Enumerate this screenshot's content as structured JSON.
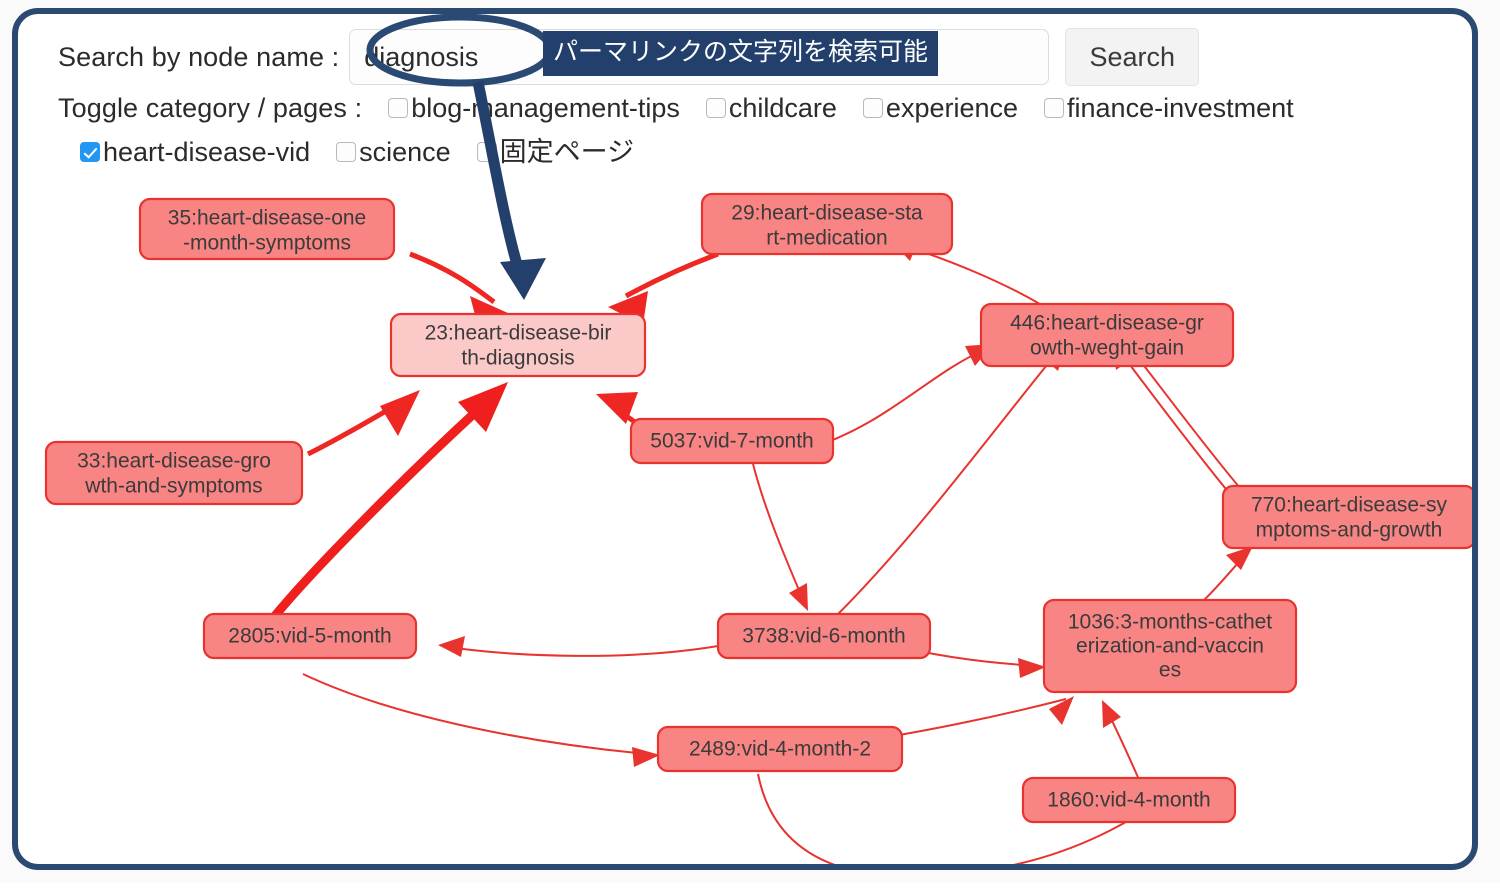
{
  "search": {
    "label": "Search by node name :",
    "value": "diagnosis",
    "placeholder": "",
    "button_label": "Search"
  },
  "annotation": {
    "text": "パーマリンクの文字列を検索可能",
    "bg_color": "#22406b",
    "text_color": "#ffffff",
    "target": "23:heart-disease-birth-diagnosis"
  },
  "toggles": {
    "label": "Toggle category / pages :",
    "items": [
      {
        "label": "blog-management-tips",
        "checked": false
      },
      {
        "label": "childcare",
        "checked": false
      },
      {
        "label": "experience",
        "checked": false
      },
      {
        "label": "finance-investment",
        "checked": false
      },
      {
        "label": "heart-disease-vid",
        "checked": true
      },
      {
        "label": "science",
        "checked": false
      },
      {
        "label": "固定ページ",
        "checked": false
      }
    ]
  },
  "colors": {
    "frame": "#2b4a73",
    "node_fill": "#f98484",
    "node_highlight_fill": "#fcc9c9",
    "node_stroke": "#e8332f",
    "edge": "#e8332f",
    "checkbox_checked": "#2196f3"
  },
  "graph": {
    "highlighted_node_id": "23",
    "nodes": [
      {
        "id": "35",
        "label": "35:heart-disease-one-month-symptoms",
        "lines": [
          "35:heart-disease-one",
          "-month-symptoms"
        ]
      },
      {
        "id": "29",
        "label": "29:heart-disease-start-medication",
        "lines": [
          "29:heart-disease-sta",
          "rt-medication"
        ]
      },
      {
        "id": "23",
        "label": "23:heart-disease-birth-diagnosis",
        "lines": [
          "23:heart-disease-bir",
          "th-diagnosis"
        ]
      },
      {
        "id": "446",
        "label": "446:heart-disease-growth-weght-gain",
        "lines": [
          "446:heart-disease-gr",
          "owth-weght-gain"
        ]
      },
      {
        "id": "33",
        "label": "33:heart-disease-growth-and-symptoms",
        "lines": [
          "33:heart-disease-gro",
          "wth-and-symptoms"
        ]
      },
      {
        "id": "5037",
        "label": "5037:vid-7-month",
        "lines": [
          "5037:vid-7-month"
        ]
      },
      {
        "id": "770",
        "label": "770:heart-disease-symptoms-and-growth",
        "lines": [
          "770:heart-disease-sy",
          "mptoms-and-growth"
        ]
      },
      {
        "id": "2805",
        "label": "2805:vid-5-month",
        "lines": [
          "2805:vid-5-month"
        ]
      },
      {
        "id": "3738",
        "label": "3738:vid-6-month",
        "lines": [
          "3738:vid-6-month"
        ]
      },
      {
        "id": "1036",
        "label": "1036:3-months-catheterization-and-vaccines",
        "lines": [
          "1036:3-months-cathet",
          "erization-and-vaccin",
          "es"
        ]
      },
      {
        "id": "2489",
        "label": "2489:vid-4-month-2",
        "lines": [
          "2489:vid-4-month-2"
        ]
      },
      {
        "id": "1860",
        "label": "1860:vid-4-month",
        "lines": [
          "1860:vid-4-month"
        ]
      }
    ],
    "edges": [
      {
        "from": "35",
        "to": "23",
        "weight": "mid"
      },
      {
        "from": "29",
        "to": "23",
        "weight": "mid"
      },
      {
        "from": "33",
        "to": "23",
        "weight": "mid"
      },
      {
        "from": "5037",
        "to": "23",
        "weight": "mid"
      },
      {
        "from": "2805",
        "to": "23",
        "weight": "thick"
      },
      {
        "from": "446",
        "to": "29",
        "weight": "thin"
      },
      {
        "from": "5037",
        "to": "446",
        "weight": "thin"
      },
      {
        "from": "3738",
        "to": "446",
        "weight": "thin"
      },
      {
        "from": "770",
        "to": "446",
        "weight": "thin"
      },
      {
        "from": "770",
        "to": "446",
        "weight": "thin"
      },
      {
        "from": "5037",
        "to": "3738",
        "weight": "thin"
      },
      {
        "from": "3738",
        "to": "2805",
        "weight": "thin"
      },
      {
        "from": "3738",
        "to": "1036",
        "weight": "thin"
      },
      {
        "from": "1036",
        "to": "770",
        "weight": "thin"
      },
      {
        "from": "2805",
        "to": "2489",
        "weight": "thin"
      },
      {
        "from": "1860",
        "to": "1036",
        "weight": "thin"
      },
      {
        "from": "2489",
        "to": "1036",
        "weight": "thin"
      },
      {
        "from": "2489",
        "to": "1860",
        "weight": "thin"
      }
    ]
  }
}
